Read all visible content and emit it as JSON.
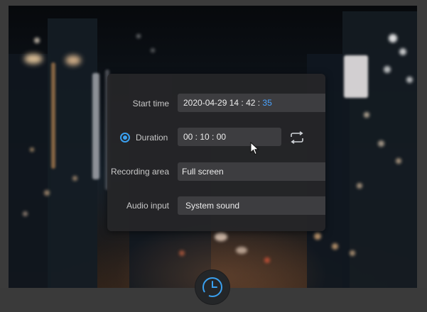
{
  "schedule": {
    "start_time": {
      "label": "Start time",
      "value_prefix": "2020-04-29 14 : 42 : ",
      "value_seconds": "35"
    },
    "duration": {
      "label": "Duration",
      "value": "00 : 10 : 00",
      "selected": true
    },
    "recording_area": {
      "label": "Recording area",
      "value": "Full screen"
    },
    "audio_input": {
      "label": "Audio input",
      "value": "System sound"
    }
  },
  "icons": {
    "loop": "repeat-icon",
    "clock": "clock-icon",
    "cursor": "mouse-pointer-icon"
  },
  "colors": {
    "accent": "#3aa0ef",
    "highlight_text": "#4aa3ff",
    "dialog_bg": "#262628",
    "field_bg": "#3d3d40",
    "frame_bg": "#3b3b3b"
  }
}
